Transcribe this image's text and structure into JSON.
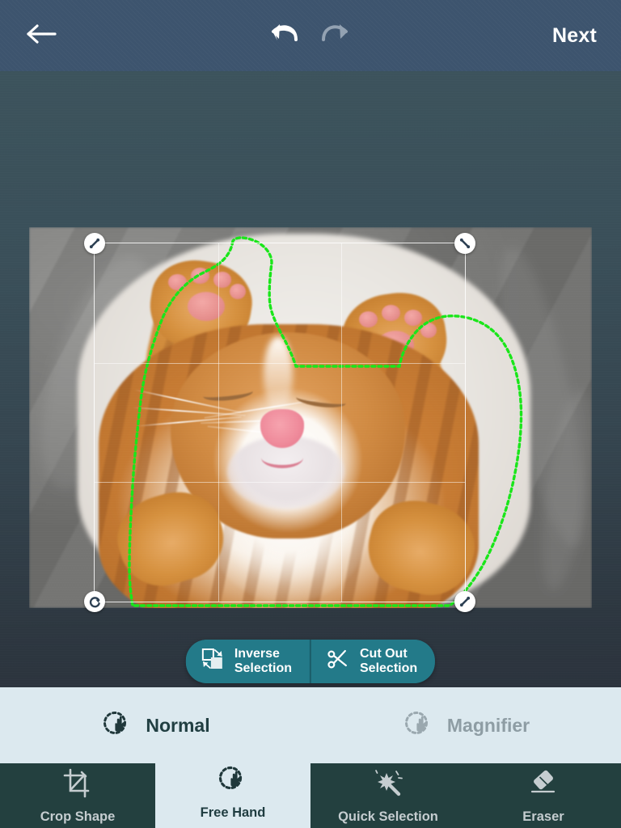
{
  "topbar": {
    "back_icon": "arrow-left-icon",
    "undo_icon": "undo-icon",
    "redo_icon": "redo-icon",
    "next_label": "Next",
    "bg_color": "#3d546e"
  },
  "canvas": {
    "bg_color_top": "#3c535c",
    "bg_color_bottom": "#2b333d",
    "selection_color": "#19e619",
    "crop_handles": [
      {
        "name": "resize-handle-top-left",
        "icon": "resize-diagonal-icon"
      },
      {
        "name": "resize-handle-top-right",
        "icon": "resize-diagonal-icon"
      },
      {
        "name": "rotate-handle-bottom-left",
        "icon": "rotate-icon"
      },
      {
        "name": "resize-handle-bottom-right",
        "icon": "resize-diagonal-icon"
      }
    ],
    "photo_subject": "sleeping-ginger-kitten"
  },
  "actions": {
    "accent_color": "#237a89",
    "buttons": [
      {
        "name": "inverse-selection-button",
        "icon": "inverse-selection-icon",
        "line1": "Inverse",
        "line2": "Selection"
      },
      {
        "name": "cut-out-selection-button",
        "icon": "scissors-icon",
        "line1": "Cut Out",
        "line2": "Selection"
      }
    ]
  },
  "modes": {
    "bg_color": "#dce9ef",
    "items": [
      {
        "name": "mode-normal",
        "label": "Normal",
        "icon": "hand-pointer-dashed-icon",
        "active": true
      },
      {
        "name": "mode-magnifier",
        "label": "Magnifier",
        "icon": "hand-pointer-dashed-icon",
        "active": false
      }
    ]
  },
  "bottom_nav": {
    "bg_color": "#23403f",
    "tabs": [
      {
        "name": "tab-crop-shape",
        "label": "Crop Shape",
        "icon": "crop-shape-icon",
        "active": false
      },
      {
        "name": "tab-free-hand",
        "label": "Free Hand",
        "icon": "free-hand-icon",
        "active": true
      },
      {
        "name": "tab-quick-selection",
        "label": "Quick Selection",
        "icon": "magic-wand-icon",
        "active": false
      },
      {
        "name": "tab-eraser",
        "label": "Eraser",
        "icon": "eraser-icon",
        "active": false
      }
    ]
  }
}
